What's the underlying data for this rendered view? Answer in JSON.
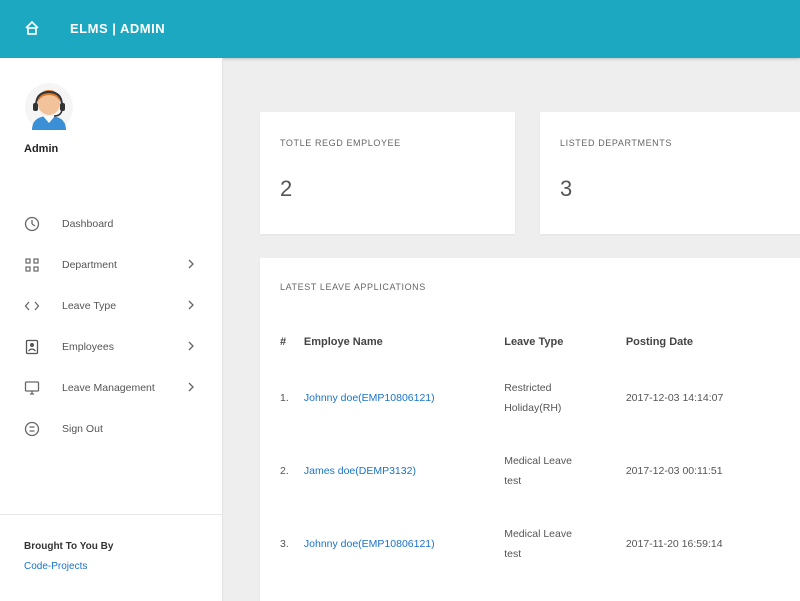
{
  "topbar": {
    "home_icon": "home-icon",
    "title": "ELMS | ADMIN"
  },
  "sidebar": {
    "avatar_icon": "avatar-headset-icon",
    "admin_name": "Admin",
    "items": [
      {
        "label": "Dashboard",
        "icon": "dashboard-icon",
        "has_submenu": false
      },
      {
        "label": "Department",
        "icon": "department-icon",
        "has_submenu": true
      },
      {
        "label": "Leave Type",
        "icon": "code-icon",
        "has_submenu": true
      },
      {
        "label": "Employees",
        "icon": "employees-icon",
        "has_submenu": true
      },
      {
        "label": "Leave Management",
        "icon": "desktop-icon",
        "has_submenu": true
      },
      {
        "label": "Sign Out",
        "icon": "sign-out-icon",
        "has_submenu": false
      }
    ],
    "footer": {
      "text": "Brought To You By",
      "link": "Code-Projects"
    }
  },
  "stats": [
    {
      "label": "TOTLE REGD EMPLOYEE",
      "value": "2"
    },
    {
      "label": "LISTED DEPARTMENTS",
      "value": "3"
    }
  ],
  "leave_applications": {
    "title": "LATEST LEAVE APPLICATIONS",
    "columns": [
      "#",
      "Employe Name",
      "Leave Type",
      "Posting Date"
    ],
    "rows": [
      {
        "num": "1.",
        "employee": "Johnny doe(EMP10806121)",
        "leave_type_line1": "Restricted",
        "leave_type_line2": "Holiday(RH)",
        "posting_date": "2017-12-03 14:14:07"
      },
      {
        "num": "2.",
        "employee": "James doe(DEMP3132)",
        "leave_type_line1": "Medical Leave",
        "leave_type_line2": "test",
        "posting_date": "2017-12-03 00:11:51"
      },
      {
        "num": "3.",
        "employee": "Johnny doe(EMP10806121)",
        "leave_type_line1": "Medical Leave",
        "leave_type_line2": "test",
        "posting_date": "2017-11-20 16:59:14"
      }
    ]
  },
  "colors": {
    "topbar": "#1ba8c0",
    "link": "#1a73c9",
    "background": "#eeeeee"
  }
}
